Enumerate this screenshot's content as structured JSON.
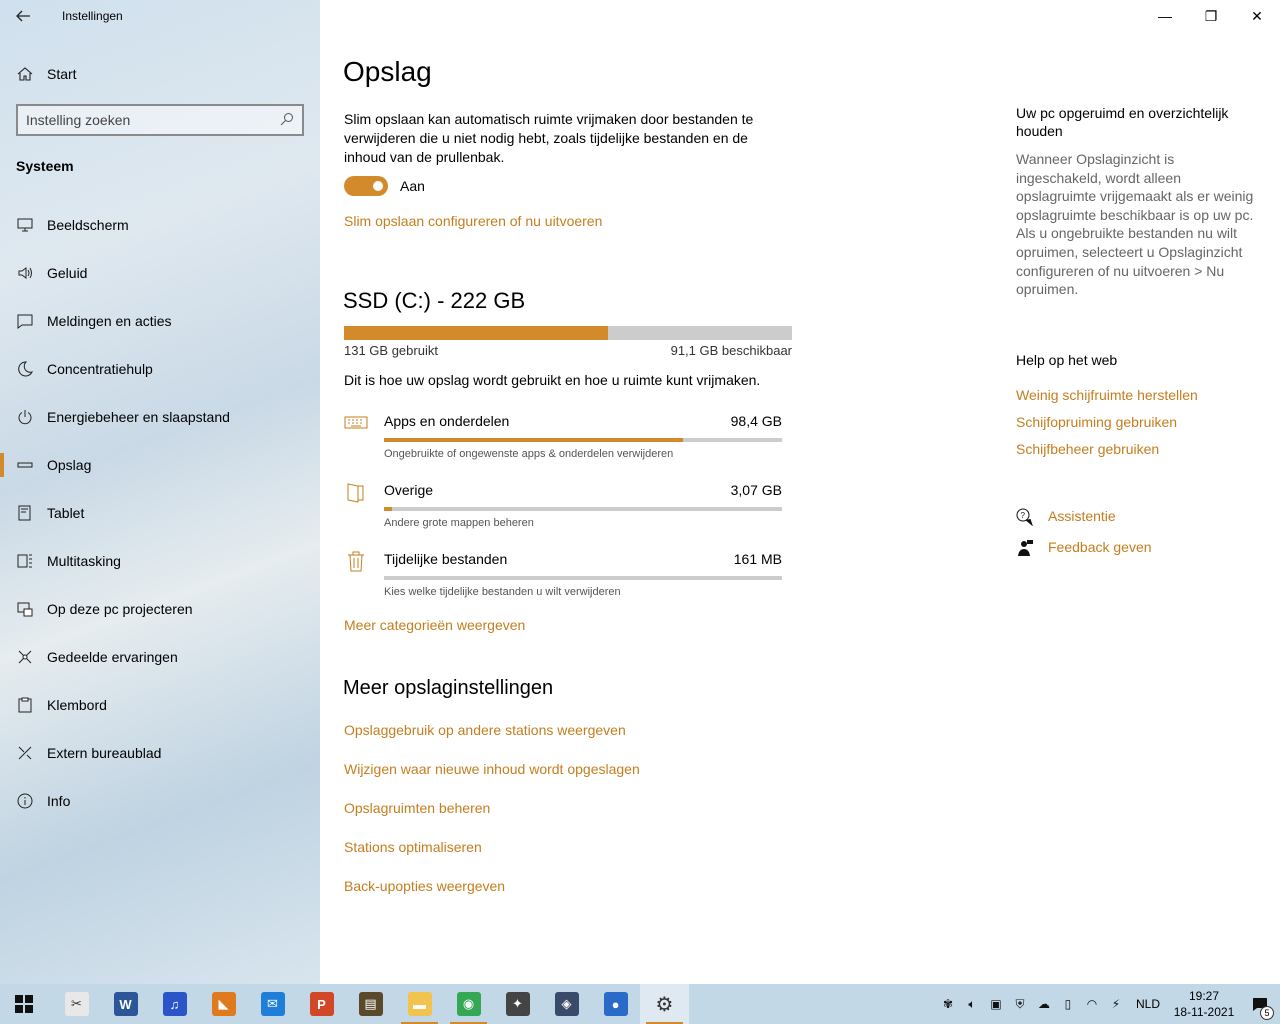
{
  "window": {
    "title": "Instellingen",
    "back_icon": "back-arrow-icon",
    "minimize_glyph": "—",
    "restore_glyph": "❐",
    "close_glyph": "✕"
  },
  "sidebar": {
    "start_label": "Start",
    "search_placeholder": "Instelling zoeken",
    "section": "Systeem",
    "items": [
      {
        "label": "Beeldscherm",
        "icon": "monitor-icon"
      },
      {
        "label": "Geluid",
        "icon": "speaker-icon"
      },
      {
        "label": "Meldingen en acties",
        "icon": "notification-icon"
      },
      {
        "label": "Concentratiehulp",
        "icon": "moon-icon"
      },
      {
        "label": "Energiebeheer en slaapstand",
        "icon": "power-icon"
      },
      {
        "label": "Opslag",
        "icon": "storage-icon",
        "active": true
      },
      {
        "label": "Tablet",
        "icon": "tablet-icon"
      },
      {
        "label": "Multitasking",
        "icon": "multitasking-icon"
      },
      {
        "label": "Op deze pc projecteren",
        "icon": "project-icon"
      },
      {
        "label": "Gedeelde ervaringen",
        "icon": "shared-icon"
      },
      {
        "label": "Klembord",
        "icon": "clipboard-icon"
      },
      {
        "label": "Extern bureaublad",
        "icon": "remote-desktop-icon"
      },
      {
        "label": "Info",
        "icon": "info-icon"
      }
    ]
  },
  "main": {
    "title": "Opslag",
    "description": "Slim opslaan kan automatisch ruimte vrijmaken door bestanden te verwijderen die u niet nodig hebt, zoals tijdelijke bestanden en de inhoud van de prullenbak.",
    "toggle_state": "Aan",
    "smart_link": "Slim opslaan configureren of nu uitvoeren",
    "drive": {
      "title": "SSD (C:) - 222 GB",
      "used": "131 GB gebruikt",
      "free": "91,1 GB beschikbaar",
      "used_fraction": 0.59
    },
    "usage_description": "Dit is hoe uw opslag wordt gebruikt en hoe u ruimte kunt vrijmaken.",
    "categories": [
      {
        "name": "Apps en onderdelen",
        "size": "98,4 GB",
        "sub": "Ongebruikte of ongewenste apps & onderdelen verwijderen",
        "fraction": 0.75,
        "icon": "keyboard-icon"
      },
      {
        "name": "Overige",
        "size": "3,07 GB",
        "sub": "Andere grote mappen beheren",
        "fraction": 0.02,
        "icon": "document-icon"
      },
      {
        "name": "Tijdelijke bestanden",
        "size": "161 MB",
        "sub": "Kies welke tijdelijke bestanden u wilt verwijderen",
        "fraction": 0.0,
        "icon": "trash-icon"
      }
    ],
    "more_categories": "Meer categorieën weergeven",
    "more_settings_title": "Meer opslaginstellingen",
    "more_links": [
      "Opslaggebruik op andere stations weergeven",
      "Wijzigen waar nieuwe inhoud wordt opgeslagen",
      "Opslagruimten beheren",
      "Stations optimaliseren",
      "Back-upopties weergeven"
    ]
  },
  "right": {
    "heading": "Uw pc opgeruimd en overzichtelijk houden",
    "paragraph": "Wanneer Opslaginzicht is ingeschakeld, wordt alleen opslagruimte vrijgemaakt als er weinig opslagruimte beschikbaar is op uw pc. Als u ongebruikte bestanden nu wilt opruimen, selecteert u Opslaginzicht configureren of nu uitvoeren > Nu opruimen.",
    "help_heading": "Help op het web",
    "help_links": [
      "Weinig schijfruimte herstellen",
      "Schijfopruiming gebruiken",
      "Schijfbeheer gebruiken"
    ],
    "assist": "Assistentie",
    "feedback": "Feedback geven"
  },
  "taskbar": {
    "apps": [
      {
        "icon": "snipping-tool-icon",
        "color": "#e8e8e8",
        "glyph": "✂"
      },
      {
        "icon": "word-icon",
        "color": "#2b579a",
        "glyph": "W"
      },
      {
        "icon": "audacity-icon",
        "color": "#2a55c8",
        "glyph": "♫"
      },
      {
        "icon": "photo-app-icon",
        "color": "#e07a1f",
        "glyph": "◣"
      },
      {
        "icon": "mail-icon",
        "color": "#1f7fd8",
        "glyph": "✉"
      },
      {
        "icon": "powerpoint-icon",
        "color": "#d24726",
        "glyph": "P"
      },
      {
        "icon": "archive-icon",
        "color": "#5a4a2a",
        "glyph": "▤"
      },
      {
        "icon": "file-explorer-icon",
        "color": "#f2c34e",
        "glyph": "▬",
        "open": true
      },
      {
        "icon": "chrome-icon",
        "color": "#34a853",
        "glyph": "◉",
        "open": true
      },
      {
        "icon": "app-icon",
        "color": "#444444",
        "glyph": "✦"
      },
      {
        "icon": "vm-icon",
        "color": "#3a4a6a",
        "glyph": "◈"
      },
      {
        "icon": "thunderbird-icon",
        "color": "#2a6ac8",
        "glyph": "●"
      },
      {
        "icon": "settings-gear-icon",
        "color": "transparent",
        "glyph": "⚙",
        "open": true,
        "active": true
      }
    ],
    "language": "NLD",
    "time": "19:27",
    "date": "18-11-2021",
    "notification_count": "5"
  }
}
